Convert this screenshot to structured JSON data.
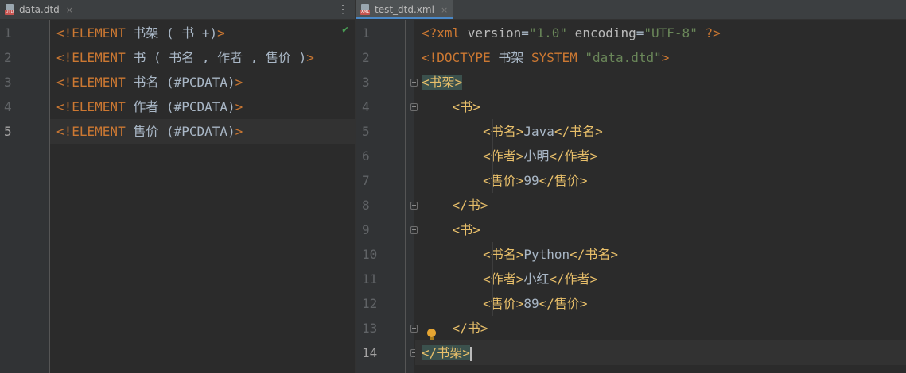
{
  "left_pane": {
    "tab": {
      "label": "data.dtd",
      "close": "×",
      "icon_badge": "DTD"
    },
    "menu_glyph": "⋮",
    "inspection_mark": "✔",
    "line_numbers": [
      "1",
      "2",
      "3",
      "4",
      "5"
    ],
    "lines": [
      [
        {
          "t": "<!ELEMENT ",
          "c": "kw"
        },
        {
          "t": "书架 ( 书 +)",
          "c": "txt"
        },
        {
          "t": ">",
          "c": "kw"
        }
      ],
      [
        {
          "t": "<!ELEMENT ",
          "c": "kw"
        },
        {
          "t": "书 ( 书名 , 作者 , 售价 )",
          "c": "txt"
        },
        {
          "t": ">",
          "c": "kw"
        }
      ],
      [
        {
          "t": "<!ELEMENT ",
          "c": "kw"
        },
        {
          "t": "书名 (#PCDATA)",
          "c": "txt"
        },
        {
          "t": ">",
          "c": "kw"
        }
      ],
      [
        {
          "t": "<!ELEMENT ",
          "c": "kw"
        },
        {
          "t": "作者 (#PCDATA)",
          "c": "txt"
        },
        {
          "t": ">",
          "c": "kw"
        }
      ],
      [
        {
          "t": "<!ELEMENT ",
          "c": "kw"
        },
        {
          "t": "售价 (#PCDATA)",
          "c": "txt"
        },
        {
          "t": ">",
          "c": "kw"
        }
      ]
    ],
    "current_line": 5
  },
  "right_pane": {
    "tab": {
      "label": "test_dtd.xml",
      "close": "×",
      "icon_badge": "XML"
    },
    "line_numbers": [
      "1",
      "2",
      "3",
      "4",
      "5",
      "6",
      "7",
      "8",
      "9",
      "10",
      "11",
      "12",
      "13",
      "14"
    ],
    "lines": [
      [
        {
          "t": "<?xml ",
          "c": "kw"
        },
        {
          "t": "version",
          "c": "attr"
        },
        {
          "t": "=",
          "c": "txt"
        },
        {
          "t": "\"1.0\"",
          "c": "str"
        },
        {
          "t": " encoding",
          "c": "attr"
        },
        {
          "t": "=",
          "c": "txt"
        },
        {
          "t": "\"UTF-8\"",
          "c": "str"
        },
        {
          "t": " ?>",
          "c": "kw"
        }
      ],
      [
        {
          "t": "<!DOCTYPE ",
          "c": "kw"
        },
        {
          "t": "书架 ",
          "c": "txt"
        },
        {
          "t": "SYSTEM ",
          "c": "kw"
        },
        {
          "t": "\"data.dtd\"",
          "c": "str"
        },
        {
          "t": ">",
          "c": "kw"
        }
      ],
      [
        {
          "t": "<书架>",
          "c": "tag hl"
        }
      ],
      [
        {
          "t": "    ",
          "c": "txt"
        },
        {
          "t": "<书>",
          "c": "tag"
        }
      ],
      [
        {
          "t": "        ",
          "c": "txt"
        },
        {
          "t": "<书名>",
          "c": "tag"
        },
        {
          "t": "Java",
          "c": "txt"
        },
        {
          "t": "</书名>",
          "c": "tag"
        }
      ],
      [
        {
          "t": "        ",
          "c": "txt"
        },
        {
          "t": "<作者>",
          "c": "tag"
        },
        {
          "t": "小明",
          "c": "txt"
        },
        {
          "t": "</作者>",
          "c": "tag"
        }
      ],
      [
        {
          "t": "        ",
          "c": "txt"
        },
        {
          "t": "<售价>",
          "c": "tag"
        },
        {
          "t": "99",
          "c": "txt"
        },
        {
          "t": "</售价>",
          "c": "tag"
        }
      ],
      [
        {
          "t": "    ",
          "c": "txt"
        },
        {
          "t": "</书>",
          "c": "tag"
        }
      ],
      [
        {
          "t": "    ",
          "c": "txt"
        },
        {
          "t": "<书>",
          "c": "tag"
        }
      ],
      [
        {
          "t": "        ",
          "c": "txt"
        },
        {
          "t": "<书名>",
          "c": "tag"
        },
        {
          "t": "Python",
          "c": "txt"
        },
        {
          "t": "</书名>",
          "c": "tag"
        }
      ],
      [
        {
          "t": "        ",
          "c": "txt"
        },
        {
          "t": "<作者>",
          "c": "tag"
        },
        {
          "t": "小红",
          "c": "txt"
        },
        {
          "t": "</作者>",
          "c": "tag"
        }
      ],
      [
        {
          "t": "        ",
          "c": "txt"
        },
        {
          "t": "<售价>",
          "c": "tag"
        },
        {
          "t": "89",
          "c": "txt"
        },
        {
          "t": "</售价>",
          "c": "tag"
        }
      ],
      [
        {
          "t": "    ",
          "c": "txt"
        },
        {
          "t": "</书>",
          "c": "tag"
        }
      ],
      [
        {
          "t": "</书架>",
          "c": "tag hl"
        }
      ]
    ],
    "current_line": 14
  },
  "colors": {
    "editor_bg": "#2b2b2b",
    "gutter_bg": "#313335",
    "keyword": "#cc7832",
    "tag": "#e8bf6a",
    "string": "#6a8759",
    "text": "#a9b7c6",
    "tab_underline": "#4a88c7",
    "check": "#499c54"
  }
}
